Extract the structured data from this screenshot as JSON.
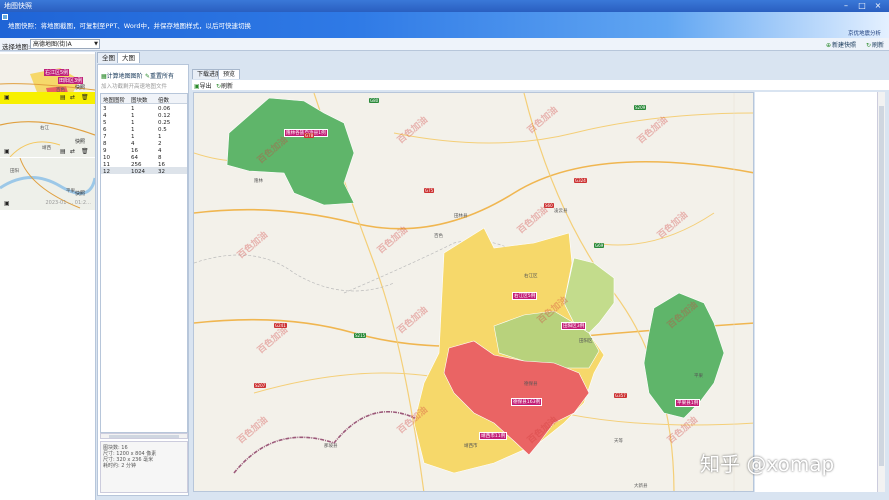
{
  "window": {
    "title": "地图快照",
    "min": "–",
    "max": "□",
    "close": "×"
  },
  "banner": {
    "desc": "地图快照：将地图截图，可复制至PPT、Word中，并保存地图样式，以后可快速切换",
    "link": "京优地震分析"
  },
  "toprow": {
    "select_label": "选择地图:",
    "select_value": "高德地图(街)A",
    "new_snapshot": "新建快照",
    "refresh": "刷新"
  },
  "left": {
    "thumbs": [
      {
        "tags": [
          "右江区5例",
          "田阳区3例"
        ],
        "action": "快照"
      },
      {
        "tags": [],
        "action": "快照"
      },
      {
        "tags": [],
        "action": "快照",
        "date": "2023-01-… 01:2…"
      }
    ],
    "places": [
      "百色",
      "右江",
      "靖西",
      "田阳",
      "平果"
    ]
  },
  "tabs1": {
    "all": "全图",
    "big": "大图"
  },
  "mid": {
    "calc": "计算地图图阶",
    "reset": "重置所有",
    "hint": "加入功截剩开高速地图文件",
    "headers": [
      "地图图阶",
      "图块数",
      "倍数"
    ],
    "rows": [
      [
        "3",
        "1",
        "0.06"
      ],
      [
        "4",
        "1",
        "0.12"
      ],
      [
        "5",
        "1",
        "0.25"
      ],
      [
        "6",
        "1",
        "0.5"
      ],
      [
        "7",
        "1",
        "1"
      ],
      [
        "8",
        "4",
        "2"
      ],
      [
        "9",
        "16",
        "4"
      ],
      [
        "10",
        "64",
        "8"
      ],
      [
        "11",
        "256",
        "16"
      ],
      [
        "12",
        "1024",
        "32"
      ]
    ],
    "info": [
      "图块数: 16",
      "尺寸: 1200 x 804 像素",
      "尺寸: 320 x 236 毫米",
      "耗时约: 2 分钟"
    ]
  },
  "tabs2": {
    "download": "下载进度",
    "preview": "预览"
  },
  "maptools": {
    "export": "导出",
    "refresh": "刷新"
  },
  "map": {
    "labels": [
      "隆林各族自治县1例",
      "右江区5例",
      "田阳区3例",
      "德保县163例",
      "靖西市11例",
      "平果县1例"
    ],
    "watermark": "百色加油",
    "roads": [
      "G80",
      "G78",
      "G75",
      "S209",
      "G324",
      "S60",
      "G69",
      "G241",
      "S207",
      "S215",
      "G357"
    ],
    "places": [
      "隆林",
      "百色",
      "田林县",
      "凌云县",
      "右江区",
      "田阳区",
      "德保县",
      "靖西市",
      "平果",
      "那坡县",
      "天等",
      "大新县"
    ]
  },
  "overlay": {
    "brand": "知乎 @xomap"
  },
  "colors": {
    "accent": "#2a5fc0",
    "highlight": "#f7f000",
    "tag": "#c0207a"
  }
}
